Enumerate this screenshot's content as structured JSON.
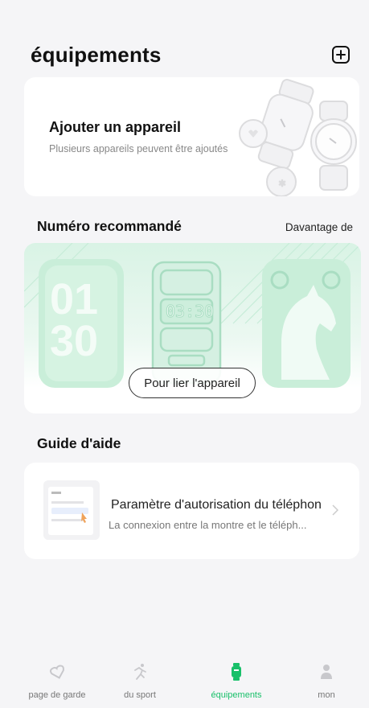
{
  "header": {
    "title": "équipements",
    "add_icon": "plus-square-icon"
  },
  "add_device": {
    "title": "Ajouter un appareil",
    "subtitle": "Plusieurs appareils peuvent être ajoutés"
  },
  "recommended": {
    "title": "Numéro recommandé",
    "more_label": "Davantage de",
    "watch_time": "03:30",
    "face_digits": [
      "01",
      "30"
    ],
    "link_button": "Pour lier l'appareil",
    "accent_color": "#bfe8d0"
  },
  "guide": {
    "title": "Guide d'aide",
    "item": {
      "title": "Paramètre d'autorisation du téléphon",
      "subtitle": "La connexion entre la montre et le téléph..."
    }
  },
  "nav": {
    "items": [
      {
        "label": "page de garde",
        "icon": "home-heart-icon",
        "active": false
      },
      {
        "label": "du sport",
        "icon": "running-icon",
        "active": false
      },
      {
        "label": "équipements",
        "icon": "watch-icon",
        "active": true
      },
      {
        "label": "mon",
        "icon": "person-icon",
        "active": false
      }
    ],
    "active_color": "#19c06a"
  }
}
